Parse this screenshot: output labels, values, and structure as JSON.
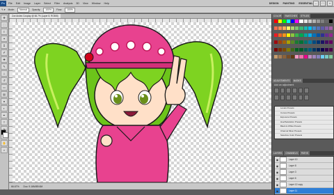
{
  "app": {
    "logo": "Ps",
    "menu": [
      "File",
      "Edit",
      "Image",
      "Layer",
      "Select",
      "Filter",
      "Analysis",
      "3D",
      "View",
      "Window",
      "Help"
    ],
    "workspaces": [
      "DESIGN",
      "PAINTING",
      "ESSENTIALS"
    ]
  },
  "options": {
    "mode_label": "Mode:",
    "mode_value": "Normal",
    "opacity_label": "Opacity:",
    "opacity_value": "100%",
    "flow_label": "Flow:",
    "flow_value": "100%"
  },
  "document": {
    "tab_label": "Zoe Andes Cosplay @ 66.7% (Layer 8, RGB/8)"
  },
  "status": {
    "zoom": "66.67%",
    "doc": "Doc: 9.16M/89.6M"
  },
  "panels": {
    "color_tabs": [
      "COLOR",
      "SWATCHES",
      "STYLES"
    ],
    "adjust_tabs": [
      "ADJUSTMENTS",
      "MASKS"
    ],
    "adjust_label": "Add an adjustment",
    "presets": [
      "Levels Presets",
      "Curves Presets",
      "Exposure Presets",
      "Hue/Saturation Presets",
      "Black & White Presets",
      "Channel Mixer Presets",
      "Selective Color Presets"
    ],
    "layers_tabs": [
      "LAYERS",
      "CHANNELS",
      "PATHS"
    ],
    "layers": [
      "Layer 10",
      "Layer 8",
      "Layer 3",
      "Layer 6",
      "Layer 12 copy",
      "Layer 11"
    ]
  },
  "colors": {
    "swatches": [
      "#ff0000",
      "#ffff00",
      "#00ff00",
      "#00ffff",
      "#0000ff",
      "#ff00ff",
      "#ffffff",
      "#e6e6e6",
      "#cccccc",
      "#b3b3b3",
      "#999999",
      "#808080",
      "#666666",
      "#000000",
      "#f26c4f",
      "#f68e56",
      "#fbaf5c",
      "#fff467",
      "#acd372",
      "#7cc576",
      "#3bb878",
      "#1abbb4",
      "#00bff3",
      "#438ccb",
      "#5574b9",
      "#605ca8",
      "#855fa8",
      "#a763a8",
      "#ed1c24",
      "#f26522",
      "#f7941d",
      "#fff200",
      "#8dc63f",
      "#39b54a",
      "#00a651",
      "#00a99d",
      "#00aeef",
      "#0072bc",
      "#0054a6",
      "#2e3192",
      "#662d91",
      "#92278f",
      "#9e0b0f",
      "#a0410d",
      "#a36209",
      "#aba000",
      "#598527",
      "#1a7b30",
      "#007236",
      "#00746b",
      "#0076a3",
      "#004b80",
      "#003471",
      "#1b1464",
      "#440e62",
      "#630460",
      "#790000",
      "#7b2e00",
      "#7d4900",
      "#827b00",
      "#406618",
      "#005e20",
      "#005826",
      "#005952",
      "#005b7f",
      "#003663",
      "#002157",
      "#0d004c",
      "#32004b",
      "#4b0049",
      "#c69c6d",
      "#a67c52",
      "#8c6239",
      "#754c24",
      "#603913",
      "#f49ac1",
      "#f06eaa",
      "#ec008c",
      "#bd8cbf",
      "#a186be",
      "#8882be",
      "#6dcff6",
      "#7accc8",
      "#82ca9c"
    ],
    "fg": "#000000",
    "bg": "#ffffff",
    "hair": "#7ed321",
    "cap": "#e8428f",
    "selected_layer": "#2f7fd6"
  },
  "icons": [
    "move-icon",
    "marquee-icon",
    "lasso-icon",
    "wand-icon",
    "crop-icon",
    "eyedropper-icon",
    "heal-icon",
    "brush-icon",
    "stamp-icon",
    "history-brush-icon",
    "eraser-icon",
    "gradient-icon",
    "blur-icon",
    "dodge-icon",
    "pen-icon",
    "type-icon",
    "path-select-icon",
    "shape-icon",
    "hand-icon",
    "zoom-icon"
  ]
}
